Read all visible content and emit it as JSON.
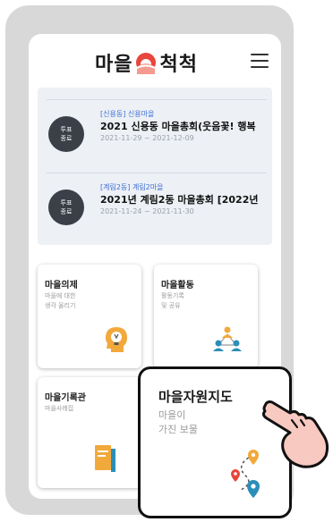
{
  "app": {
    "logo_text_left": "마을",
    "logo_text_right": "척척",
    "logo_icon": "sunrise-logo-icon",
    "menu_icon": "hamburger-menu-icon"
  },
  "notices": [
    {
      "badge_line1": "투표",
      "badge_line2": "종료",
      "category": "[신용동] 신용마을",
      "title": "2021 신용동 마을총회(웃음꽃! 행복",
      "date": "2021-11-29 ~ 2021-12-09"
    },
    {
      "badge_line1": "투표",
      "badge_line2": "종료",
      "category": "[계림2동] 계림2마을",
      "title": "2021년 계림2동 마을총회 [2022년",
      "date": "2021-11-24 ~ 2021-11-30"
    }
  ],
  "cards": {
    "agenda": {
      "title": "마을의제",
      "desc_line1": "마을에 대한",
      "desc_line2": "생각 올리기",
      "icon": "lightbulb-head-icon"
    },
    "activity": {
      "title": "마을활동",
      "desc_line1": "활동기록",
      "desc_line2": "및 공유",
      "icon": "people-network-icon"
    },
    "archive": {
      "title": "마을기록관",
      "desc_line1": "마을사례집",
      "icon": "book-icon"
    },
    "resource_map": {
      "title": "마을자원지도",
      "desc_line1": "마을이",
      "desc_line2": "가진 보물",
      "icon": "map-pin-route-icon"
    }
  },
  "pointer_icon": "pointing-hand-icon",
  "colors": {
    "accent_blue": "#3b6fd6",
    "badge_dark": "#3b3f48",
    "notice_bg": "#edf0f5",
    "logo_red": "#e8453c",
    "icon_orange": "#f2a93b",
    "icon_teal": "#2a8fb8",
    "hand_fill": "#f7c9c0"
  }
}
